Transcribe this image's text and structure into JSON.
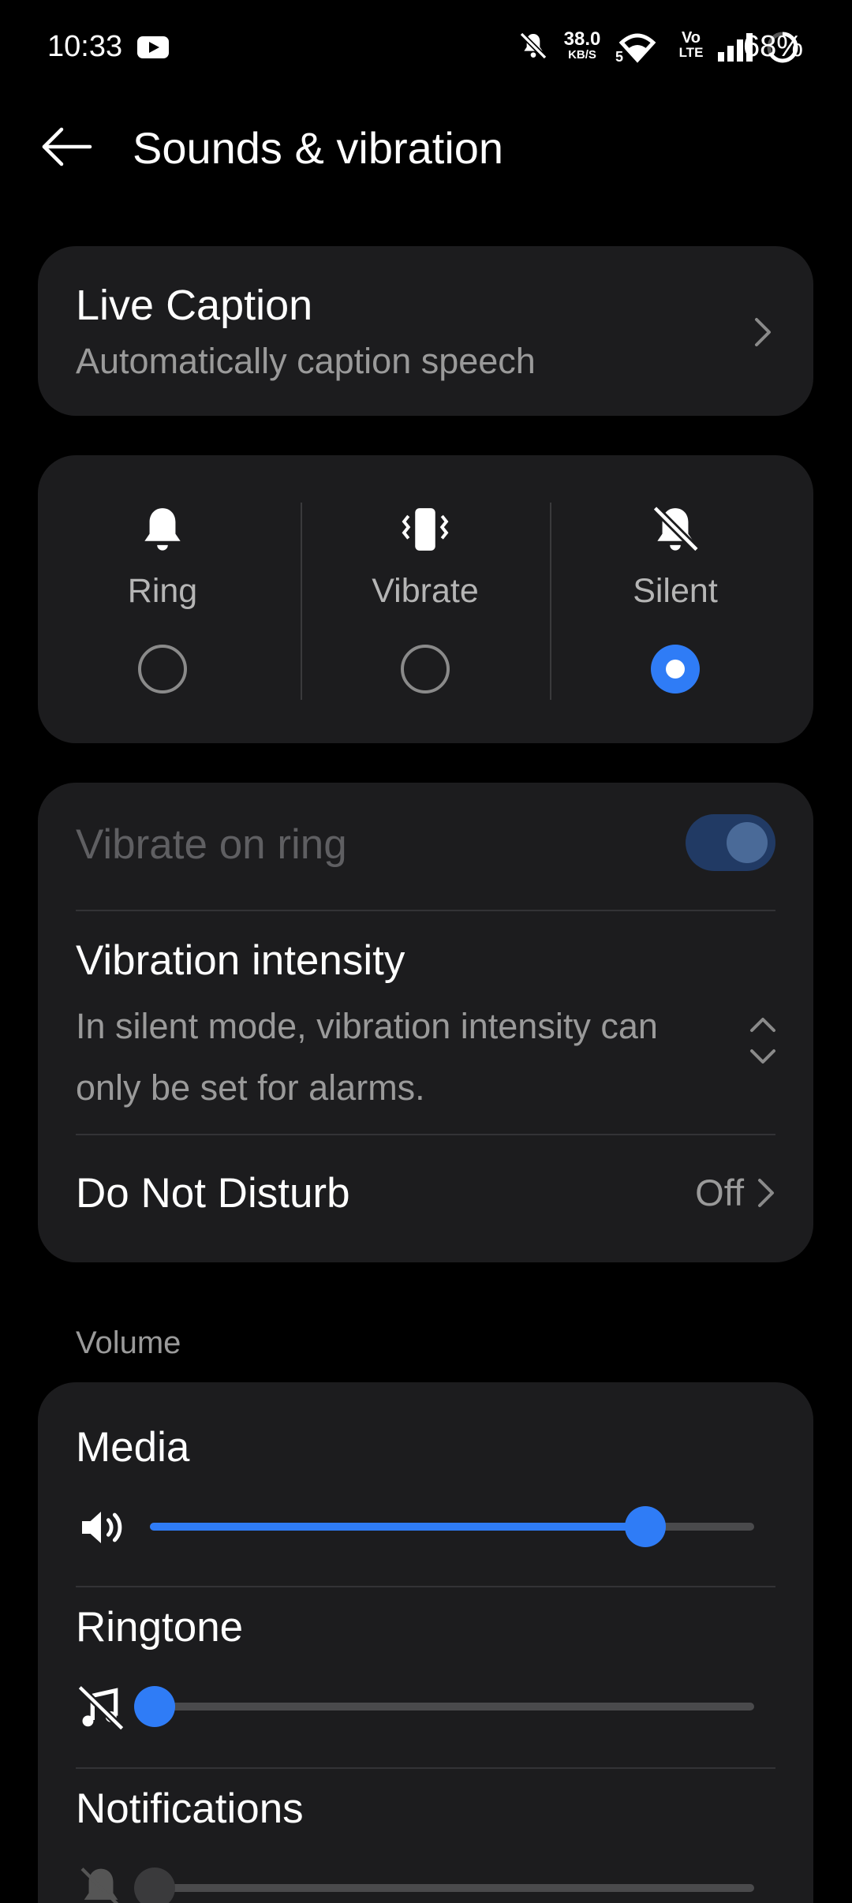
{
  "status_bar": {
    "time": "10:33",
    "network_speed_value": "38.0",
    "network_speed_unit": "KB/S",
    "wifi_badge": "5",
    "volte_top": "Vo",
    "volte_bottom": "LTE",
    "battery": "68%",
    "battery_level": 0.68
  },
  "header": {
    "title": "Sounds & vibration",
    "back_icon": "arrow-left-icon"
  },
  "live_caption": {
    "title": "Live Caption",
    "subtitle": "Automatically caption speech"
  },
  "sound_modes": {
    "selected": "Silent",
    "modes": [
      {
        "label": "Ring",
        "icon": "bell-icon",
        "selected": false
      },
      {
        "label": "Vibrate",
        "icon": "vibrate-phone-icon",
        "selected": false
      },
      {
        "label": "Silent",
        "icon": "bell-off-icon",
        "selected": true
      }
    ]
  },
  "settings": {
    "vibrate_on_ring": {
      "label": "Vibrate on ring",
      "enabled": false,
      "on": true
    },
    "vibration_intensity": {
      "title": "Vibration intensity",
      "subtitle": "In silent mode, vibration intensity can only be set for alarms."
    },
    "do_not_disturb": {
      "title": "Do Not Disturb",
      "value": "Off"
    }
  },
  "volume": {
    "section_label": "Volume",
    "rows": [
      {
        "title": "Media",
        "icon": "speaker-icon",
        "level": 0.82
      },
      {
        "title": "Ringtone",
        "icon": "music-off-icon",
        "level": 0.0
      },
      {
        "title": "Notifications",
        "icon": "bell-off-icon",
        "level": 0.0
      }
    ]
  },
  "colors": {
    "background": "#000000",
    "card": "#1c1c1e",
    "accent": "#2f7cf6",
    "secondary_text": "#9a9a9a"
  }
}
